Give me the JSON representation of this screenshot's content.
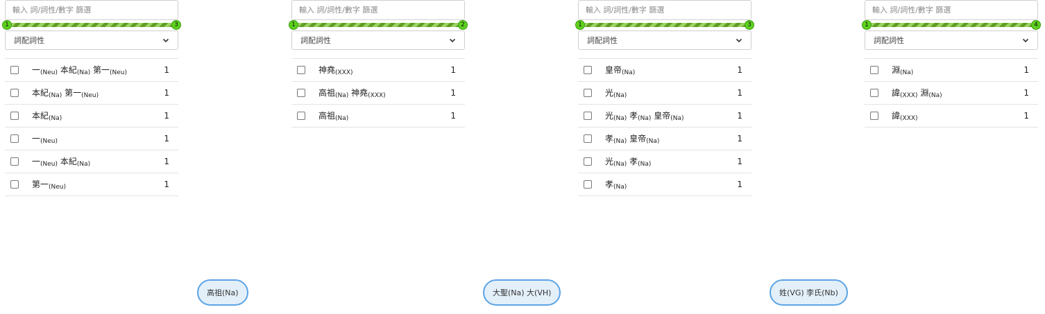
{
  "search_placeholder": "輸入 詞/詞性/數字 篩選",
  "select_label": "詞配詞性",
  "colors": {
    "accent": "#5ed11f",
    "pill_border": "#5ba4e6",
    "pill_bg": "#e3eff9"
  },
  "panels": [
    {
      "slider": {
        "min_label": "1",
        "max_label": "3"
      },
      "rows": [
        {
          "parts": [
            {
              "w": "一",
              "t": "(Neu)"
            },
            {
              "w": "本紀",
              "t": "(Na)"
            },
            {
              "w": "第一",
              "t": "(Neu)"
            }
          ],
          "count": "1"
        },
        {
          "parts": [
            {
              "w": "本紀",
              "t": "(Na)"
            },
            {
              "w": "第一",
              "t": "(Neu)"
            }
          ],
          "count": "1"
        },
        {
          "parts": [
            {
              "w": "本紀",
              "t": "(Na)"
            }
          ],
          "count": "1"
        },
        {
          "parts": [
            {
              "w": "一",
              "t": "(Neu)"
            }
          ],
          "count": "1"
        },
        {
          "parts": [
            {
              "w": "一",
              "t": "(Neu)"
            },
            {
              "w": "本紀",
              "t": "(Na)"
            }
          ],
          "count": "1"
        },
        {
          "parts": [
            {
              "w": "第一",
              "t": "(Neu)"
            }
          ],
          "count": "1"
        }
      ]
    },
    {
      "slider": {
        "min_label": "1",
        "max_label": "2"
      },
      "rows": [
        {
          "parts": [
            {
              "w": "神堯",
              "t": "(XXX)"
            }
          ],
          "count": "1"
        },
        {
          "parts": [
            {
              "w": "高祖",
              "t": "(Na)"
            },
            {
              "w": "神堯",
              "t": "(XXX)"
            }
          ],
          "count": "1"
        },
        {
          "parts": [
            {
              "w": "高祖",
              "t": "(Na)"
            }
          ],
          "count": "1"
        }
      ]
    },
    {
      "slider": {
        "min_label": "1",
        "max_label": "3"
      },
      "rows": [
        {
          "parts": [
            {
              "w": "皇帝",
              "t": "(Na)"
            }
          ],
          "count": "1"
        },
        {
          "parts": [
            {
              "w": "光",
              "t": "(Na)"
            }
          ],
          "count": "1"
        },
        {
          "parts": [
            {
              "w": "光",
              "t": "(Na)"
            },
            {
              "w": "孝",
              "t": "(Na)"
            },
            {
              "w": "皇帝",
              "t": "(Na)"
            }
          ],
          "count": "1"
        },
        {
          "parts": [
            {
              "w": "孝",
              "t": "(Na)"
            },
            {
              "w": "皇帝",
              "t": "(Na)"
            }
          ],
          "count": "1"
        },
        {
          "parts": [
            {
              "w": "光",
              "t": "(Na)"
            },
            {
              "w": "孝",
              "t": "(Na)"
            }
          ],
          "count": "1"
        },
        {
          "parts": [
            {
              "w": "孝",
              "t": "(Na)"
            }
          ],
          "count": "1"
        }
      ]
    },
    {
      "slider": {
        "min_label": "1",
        "max_label": "4"
      },
      "rows": [
        {
          "parts": [
            {
              "w": "淵",
              "t": "(Na)"
            }
          ],
          "count": "1"
        },
        {
          "parts": [
            {
              "w": "諱",
              "t": "(XXX)"
            },
            {
              "w": "淵",
              "t": "(Na)"
            }
          ],
          "count": "1"
        },
        {
          "parts": [
            {
              "w": "諱",
              "t": "(XXX)"
            }
          ],
          "count": "1"
        }
      ]
    }
  ],
  "pills": [
    {
      "label": "高祖(Na)"
    },
    {
      "label": "大聖(Na) 大(VH)"
    },
    {
      "label": "姓(VG) 李氏(Nb)"
    }
  ]
}
